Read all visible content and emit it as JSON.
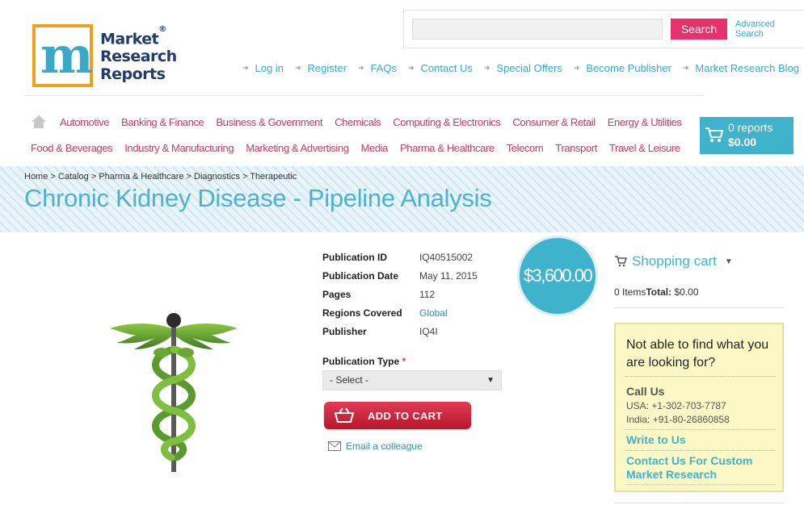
{
  "logo": {
    "line1": "Market",
    "line2": "Research",
    "line3": "Reports",
    "reg": "®"
  },
  "search": {
    "placeholder": "",
    "button": "Search",
    "advanced": "Advanced Search"
  },
  "top_links": [
    "Log in",
    "Register",
    "FAQs",
    "Contact Us",
    "Special Offers",
    "Become Publisher",
    "Market Research Blog"
  ],
  "categories_row1": [
    "Automotive",
    "Banking & Finance",
    "Business & Government",
    "Chemicals",
    "Computing & Electronics",
    "Consumer & Retail",
    "Energy & Utilities"
  ],
  "categories_row2": [
    "Food & Beverages",
    "Industry & Manufacturing",
    "Marketing & Advertising",
    "Media",
    "Pharma & Healthcare",
    "Telecom",
    "Transport",
    "Travel & Leisure"
  ],
  "cart_widget": {
    "reports": "0 reports",
    "total": "$0.00"
  },
  "breadcrumb": "Home > Catalog > Pharma & Healthcare > Diagnostics > Therapeutic",
  "title": "Chronic Kidney Disease - Pipeline Analysis",
  "details": [
    {
      "label": "Publication ID",
      "value": "IQ40515002"
    },
    {
      "label": "Publication Date",
      "value": "May 11, 2015"
    },
    {
      "label": "Pages",
      "value": "112"
    },
    {
      "label": "Regions Covered",
      "value": "Global"
    },
    {
      "label": "Publisher",
      "value": "IQ4I"
    }
  ],
  "price": "$3,600.00",
  "publication_type": {
    "label": "Publication Type",
    "required": "*",
    "selected": "- Select -"
  },
  "add_to_cart": "ADD TO CART",
  "email_colleague": "Email a colleague",
  "shopping_cart": {
    "title": "Shopping cart",
    "items": "0 Items",
    "total_label": "Total:",
    "total_value": " $0.00"
  },
  "help": {
    "question": "Not able to find what you are looking for?",
    "call_us": "Call Us",
    "usa": "USA: +1-302-703-7787",
    "india": "India: +91-80-26860858",
    "write": "Write to Us",
    "custom": "Contact Us For Custom Market Research"
  },
  "colors": {
    "accent_blue": "#3fb2cc",
    "accent_pink": "#e5326b",
    "add_cart_red": "#d0263f",
    "help_bg": "#fbf8c6"
  }
}
